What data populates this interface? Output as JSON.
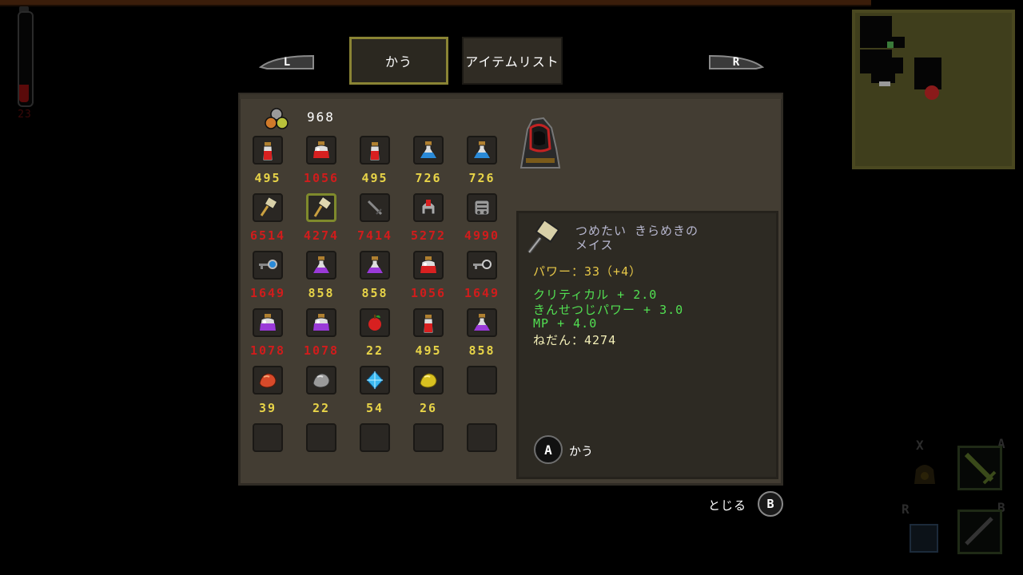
{
  "hud": {
    "health_text": "23",
    "shoulder_left": "L",
    "shoulder_right": "R",
    "hud_x": "X",
    "hud_a": "A",
    "hud_r": "R",
    "hud_b": "B"
  },
  "tabs": [
    {
      "label": "かう",
      "selected": true
    },
    {
      "label": "アイテムリスト",
      "selected": false
    }
  ],
  "money": {
    "icon": "coins-icon",
    "value": "968"
  },
  "shop_items": [
    [
      {
        "icon": "red-potion-icon",
        "price": "495",
        "affordable": true
      },
      {
        "icon": "red-flask-icon",
        "price": "1056",
        "affordable": false
      },
      {
        "icon": "red-potion-icon",
        "price": "495",
        "affordable": true
      },
      {
        "icon": "blue-potion-icon",
        "price": "726",
        "affordable": true
      },
      {
        "icon": "blue-potion-icon",
        "price": "726",
        "affordable": true
      }
    ],
    [
      {
        "icon": "hammer-icon",
        "price": "6514",
        "affordable": false
      },
      {
        "icon": "mace-icon",
        "price": "4274",
        "affordable": false,
        "selected": true
      },
      {
        "icon": "sword-icon",
        "price": "7414",
        "affordable": false
      },
      {
        "icon": "helmet-icon",
        "price": "5272",
        "affordable": false
      },
      {
        "icon": "armor-icon",
        "price": "4990",
        "affordable": false
      }
    ],
    [
      {
        "icon": "blue-key-icon",
        "price": "1649",
        "affordable": false
      },
      {
        "icon": "purple-potion-icon",
        "price": "858",
        "affordable": true
      },
      {
        "icon": "purple-potion-icon",
        "price": "858",
        "affordable": true
      },
      {
        "icon": "red-flask-icon",
        "price": "1056",
        "affordable": false
      },
      {
        "icon": "grey-key-icon",
        "price": "1649",
        "affordable": false
      }
    ],
    [
      {
        "icon": "purple-flask-icon",
        "price": "1078",
        "affordable": false
      },
      {
        "icon": "purple-flask-icon",
        "price": "1078",
        "affordable": false
      },
      {
        "icon": "apple-icon",
        "price": "22",
        "affordable": true
      },
      {
        "icon": "red-potion-icon",
        "price": "495",
        "affordable": true
      },
      {
        "icon": "purple-potion-icon",
        "price": "858",
        "affordable": true
      }
    ],
    [
      {
        "icon": "red-ore-icon",
        "price": "39",
        "affordable": true
      },
      {
        "icon": "grey-ore-icon",
        "price": "22",
        "affordable": true
      },
      {
        "icon": "crystal-icon",
        "price": "54",
        "affordable": true
      },
      {
        "icon": "gold-ore-icon",
        "price": "26",
        "affordable": true
      },
      {
        "icon": "empty-slot",
        "price": "",
        "affordable": true
      }
    ],
    [
      {
        "icon": "empty-slot",
        "price": "",
        "affordable": true
      },
      {
        "icon": "empty-slot",
        "price": "",
        "affordable": true
      },
      {
        "icon": "empty-slot",
        "price": "",
        "affordable": true
      },
      {
        "icon": "empty-slot",
        "price": "",
        "affordable": true
      },
      {
        "icon": "empty-slot",
        "price": "",
        "affordable": true
      }
    ]
  ],
  "detail": {
    "icon": "mace-icon",
    "name_line1": "つめたい きらめきの",
    "name_line2": "メイス",
    "power": "パワー：33（+4）",
    "bonus1": "クリティカル + 2.0",
    "bonus2": "きんせつじパワー + 3.0",
    "bonus3": "MP + 4.0",
    "sale_price": "ねだん：4274",
    "action_button": "A",
    "action_label": "かう"
  },
  "footer": {
    "close_label": "とじる",
    "close_button": "B"
  },
  "colors": {
    "affordable_price": "#e8d448",
    "unaffordable_price": "#d11c1c",
    "bonus_text": "#52e052",
    "power_text": "#e8c848",
    "panel_bg": "#433d33",
    "selected_border": "#7f8a2c"
  }
}
